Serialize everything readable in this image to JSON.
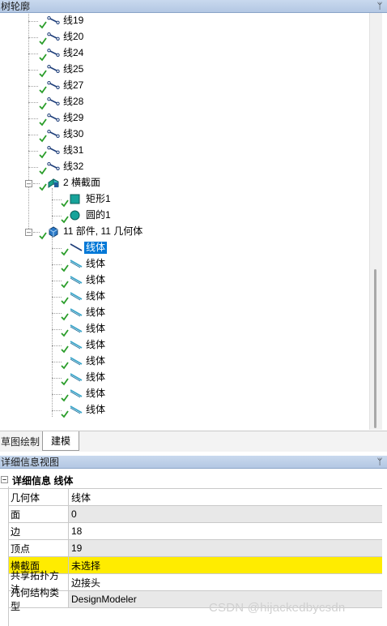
{
  "tree_panel": {
    "title": "树轮廓",
    "pin_glyph": "ᛘ"
  },
  "tree": {
    "lines": [
      "线19",
      "线20",
      "线24",
      "线25",
      "线27",
      "线28",
      "线29",
      "线30",
      "线31",
      "线32"
    ],
    "cross_sections": {
      "label": "2 横截面",
      "items": [
        "矩形1",
        "圆的1"
      ]
    },
    "parts": {
      "label": "11 部件, 11 几何体",
      "items": [
        "线体",
        "线体",
        "线体",
        "线体",
        "线体",
        "线体",
        "线体",
        "线体",
        "线体",
        "线体",
        "线体"
      ]
    }
  },
  "tabs": {
    "sketch": "草图绘制",
    "model": "建模"
  },
  "details_panel": {
    "title": "详细信息视图",
    "pin_glyph": "ᛘ",
    "header": "详细信息 线体",
    "collapse_glyph": "–",
    "rows": [
      {
        "key": "几何体",
        "value": "线体"
      },
      {
        "key": "面",
        "value": "0"
      },
      {
        "key": "边",
        "value": "18"
      },
      {
        "key": "顶点",
        "value": "19"
      },
      {
        "key": "横截面",
        "value": "未选择"
      },
      {
        "key": "共享拓扑方法",
        "value": "边接头"
      },
      {
        "key": "几何结构类型",
        "value": "DesignModeler"
      }
    ]
  },
  "expander_glyph": "–",
  "watermark": "CSDN @hijackedbycsdn",
  "colors": {
    "selection": "#0078d7",
    "highlight_row": "#ffec00",
    "header_bar": "#b3c7e3",
    "check": "#2a9d2a"
  }
}
